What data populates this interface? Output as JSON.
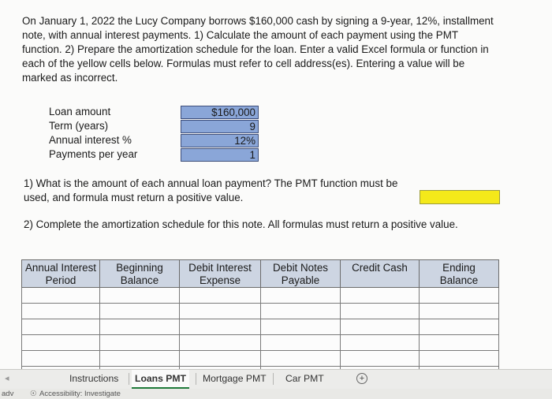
{
  "problem": {
    "line1": "On January 1, 2022 the Lucy Company borrows $160,000 cash by signing a 9-year, 12%, installment",
    "line2": "note, with annual interest payments. 1) Calculate the amount of each payment using the PMT",
    "line3": "function. 2) Prepare the amortization schedule for the loan. Enter a valid Excel formula or function in",
    "line4": "each of the yellow cells below. Formulas must refer to cell address(es). Entering a value will be",
    "line5": "marked as incorrect."
  },
  "inputs": [
    {
      "label": "Loan amount",
      "value": "$160,000"
    },
    {
      "label": "Term (years)",
      "value": "9"
    },
    {
      "label": "Annual interest %",
      "value": "12%"
    },
    {
      "label": "Payments per year",
      "value": "1"
    }
  ],
  "question1": {
    "line1": "1) What is the amount of each annual loan payment? The PMT function must be",
    "line2": "used, and formula must return a positive value."
  },
  "question2": "2) Complete the amortization schedule for this note. All formulas must return a positive value.",
  "schedule": {
    "headers": [
      {
        "l1": "Annual Interest",
        "l2": "Period"
      },
      {
        "l1": "Beginning",
        "l2": "Balance"
      },
      {
        "l1": "Debit Interest",
        "l2": "Expense"
      },
      {
        "l1": "Debit Notes",
        "l2": "Payable"
      },
      {
        "l1": "Credit Cash",
        "l2": ""
      },
      {
        "l1": "Ending",
        "l2": "Balance"
      }
    ]
  },
  "tabs": [
    "Instructions",
    "Loans PMT",
    "Mortgage PMT",
    "Car PMT"
  ],
  "active_tab": "Loans PMT",
  "status": {
    "ready": "adv",
    "accessibility": "Accessibility: Investigate"
  },
  "colors": {
    "input_fill": "#8aa6d8",
    "answer_fill": "#f4e91a",
    "header_fill": "#cdd5e2"
  }
}
